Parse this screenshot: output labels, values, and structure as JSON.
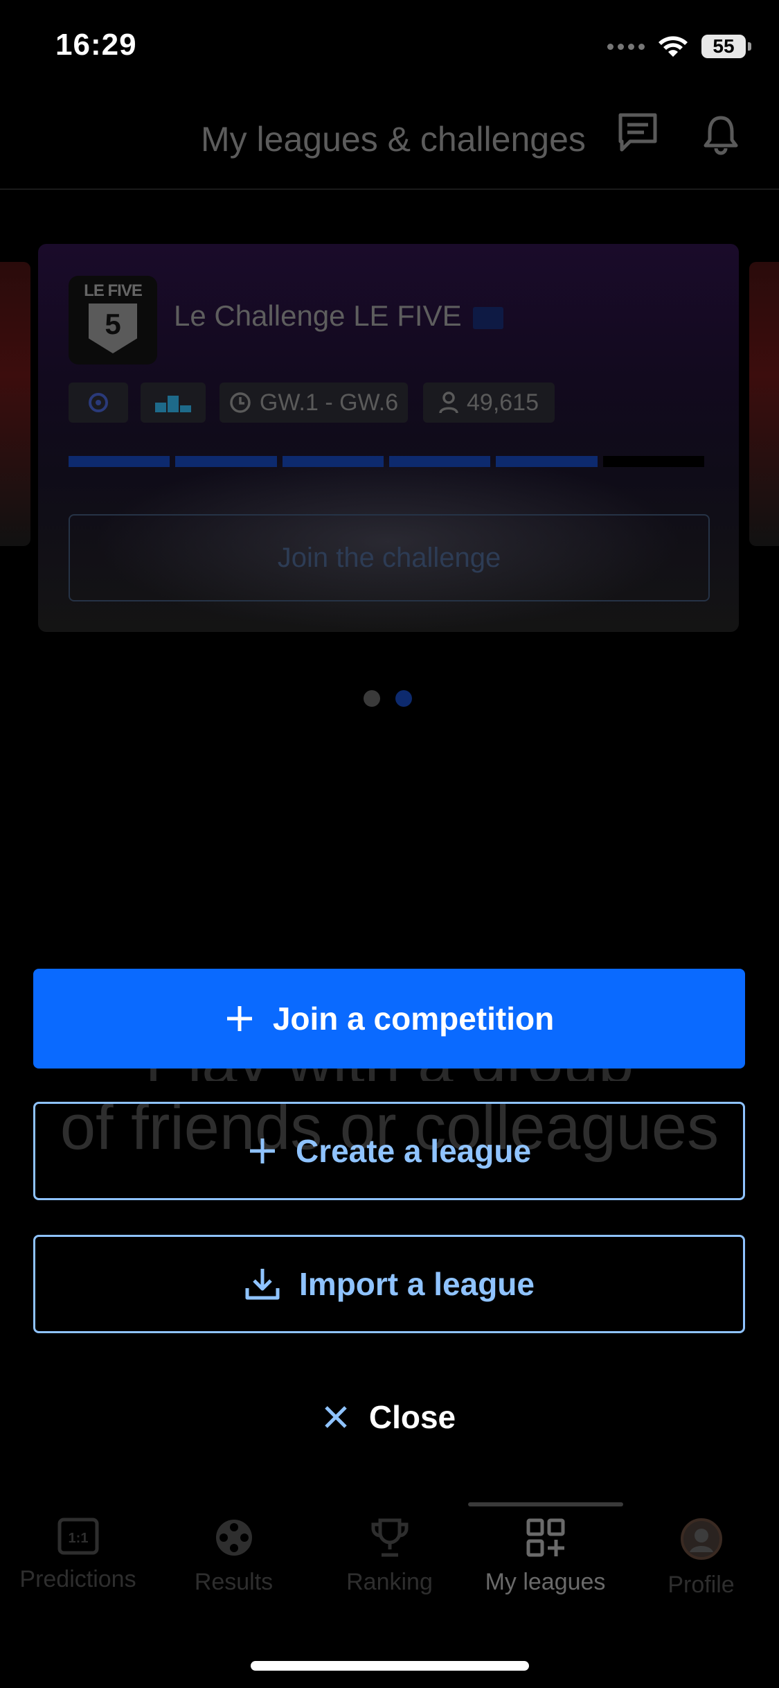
{
  "status_bar": {
    "time": "16:29",
    "battery": "55"
  },
  "header": {
    "title": "My leagues & challenges",
    "icons": [
      "chat-icon",
      "bell-icon"
    ]
  },
  "card": {
    "logo_text": "LE FIVE",
    "logo_number": "5",
    "title": "Le Challenge LE FIVE",
    "gameweeks": "GW.1 - GW.6",
    "participants": "49,615",
    "progress": {
      "filled_segments": 5,
      "total_segments": 6
    },
    "cta": "Join the challenge"
  },
  "carousel": {
    "count": 2,
    "active_index": 1
  },
  "background_text": {
    "line1": "Play with a group",
    "line2": "of friends or colleagues"
  },
  "actions": {
    "join_competition": "Join a competition",
    "create_league": "Create a league",
    "import_league": "Import a league",
    "close": "Close"
  },
  "tabs": [
    {
      "label": "Predictions",
      "icon": "scoreboard-icon"
    },
    {
      "label": "Results",
      "icon": "film-reel-icon"
    },
    {
      "label": "Ranking",
      "icon": "trophy-icon"
    },
    {
      "label": "My leagues",
      "icon": "grid-plus-icon",
      "active": true
    },
    {
      "label": "Profile",
      "icon": "avatar"
    }
  ],
  "colors": {
    "primary": "#0a6aff",
    "outline": "#8fc3ff",
    "background": "#000000"
  }
}
